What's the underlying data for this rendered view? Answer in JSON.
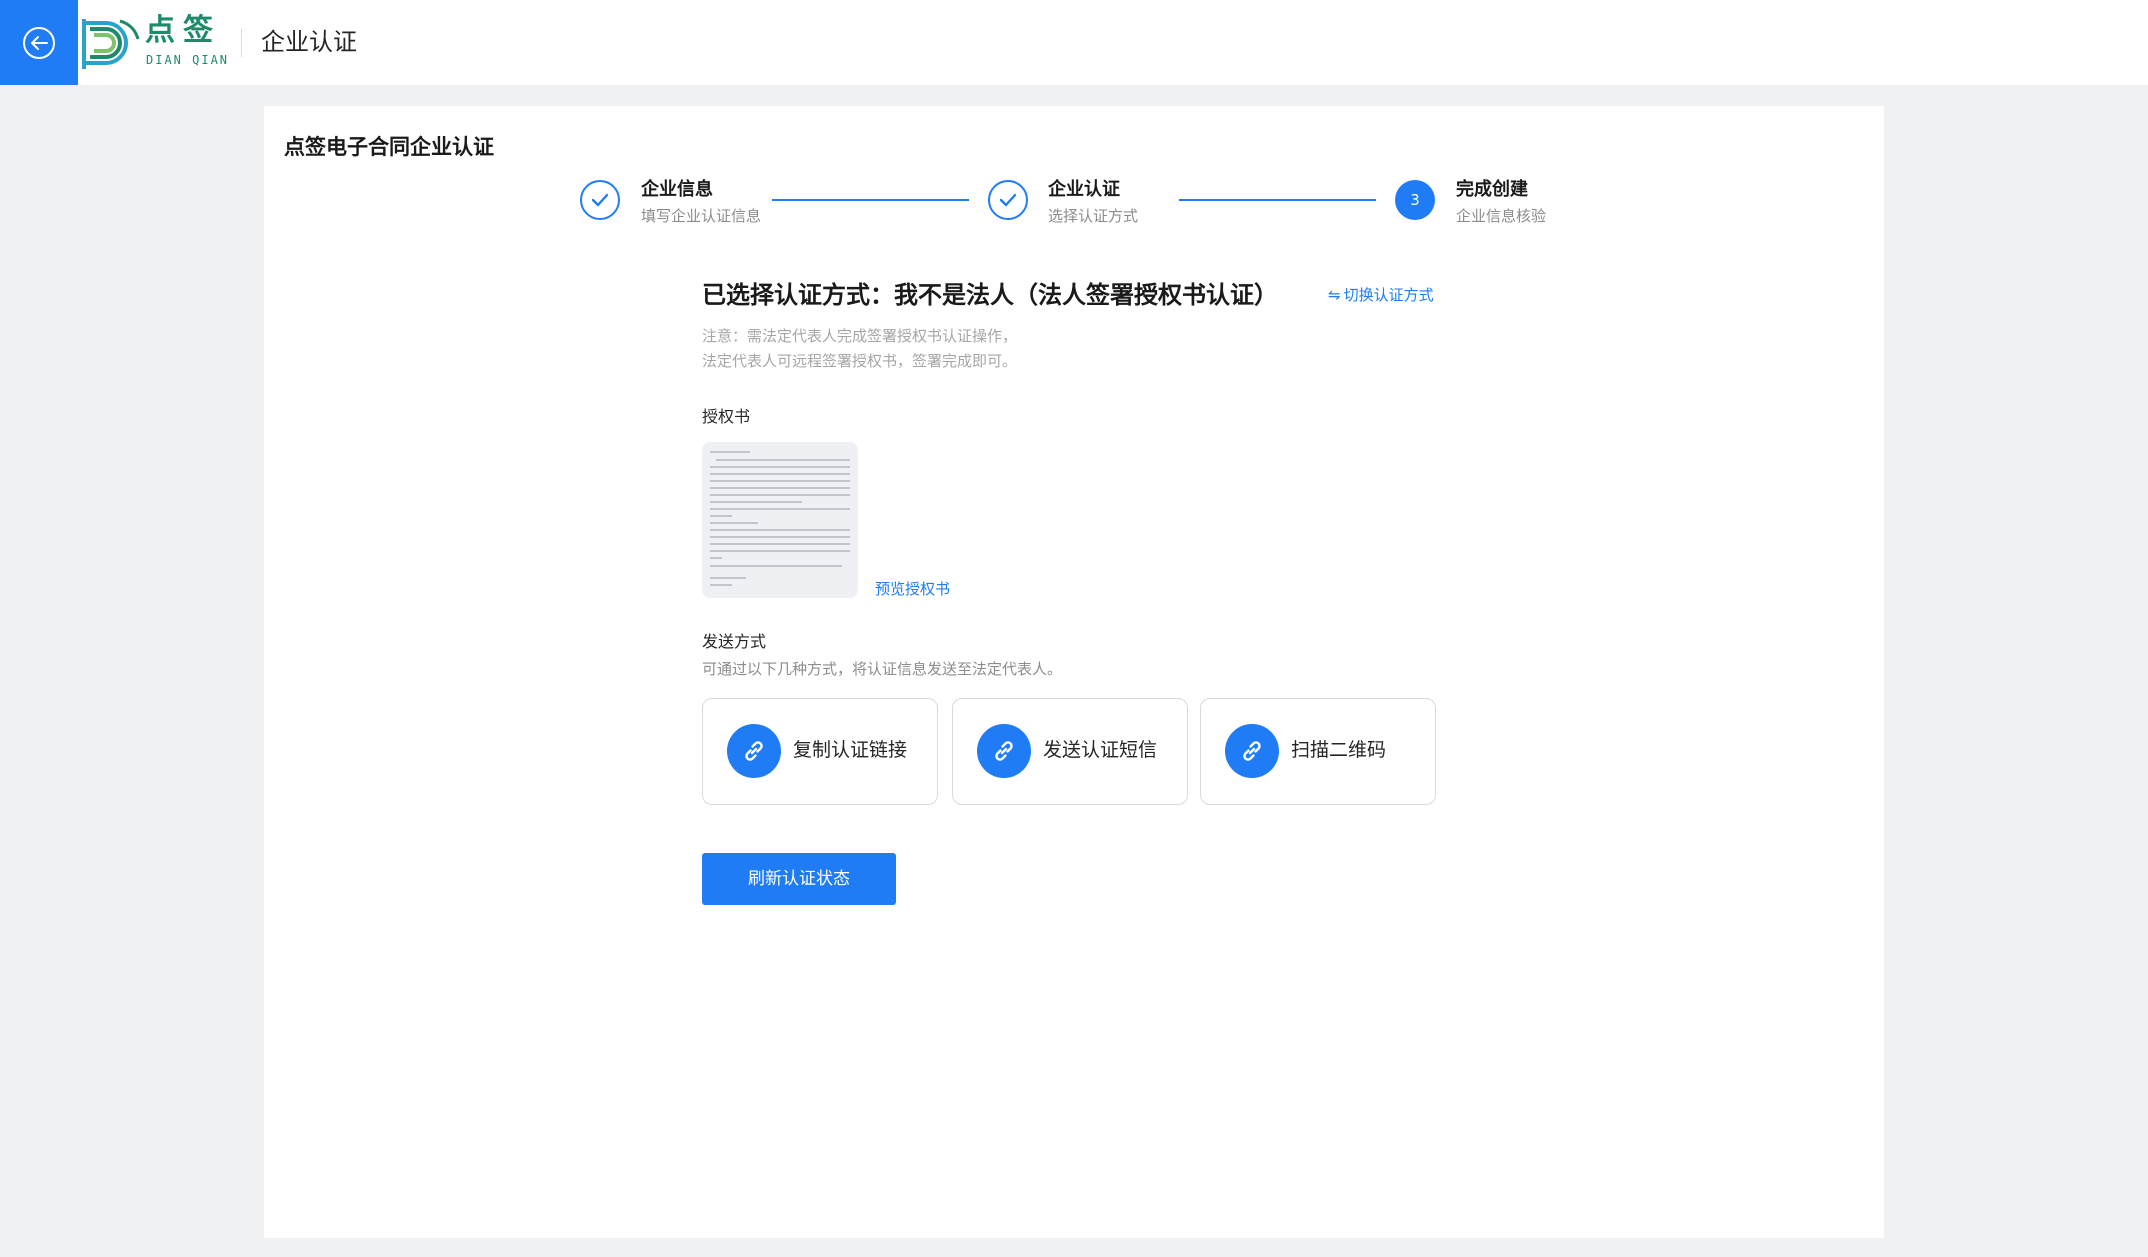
{
  "header": {
    "logo_cn": "点签",
    "logo_en": "DIAN QIAN",
    "title": "企业认证"
  },
  "card": {
    "title": "点签电子合同企业认证"
  },
  "steps": [
    {
      "title": "企业信息",
      "desc": "填写企业认证信息",
      "status": "done"
    },
    {
      "title": "企业认证",
      "desc": "选择认证方式",
      "status": "done"
    },
    {
      "number": "3",
      "title": "完成创建",
      "desc": "企业信息核验",
      "status": "active"
    }
  ],
  "method": {
    "heading": "已选择认证方式：我不是法人（法人签署授权书认证）",
    "switch_label": "切换认证方式",
    "note_line1": "注意：需法定代表人完成签署授权书认证操作，",
    "note_line2": "法定代表人可远程签署授权书，签署完成即可。"
  },
  "authorization": {
    "label": "授权书",
    "preview_label": "预览授权书"
  },
  "send": {
    "label": "发送方式",
    "hint": "可通过以下几种方式，将认证信息发送至法定代表人。",
    "options": [
      {
        "label": "复制认证链接",
        "icon": "link-icon"
      },
      {
        "label": "发送认证短信",
        "icon": "link-icon"
      },
      {
        "label": "扫描二维码",
        "icon": "link-icon"
      }
    ]
  },
  "refresh_button": "刷新认证状态",
  "colors": {
    "accent": "#1f7cf5",
    "brand_green": "#1e8a6b",
    "background": "#f0f1f3"
  }
}
